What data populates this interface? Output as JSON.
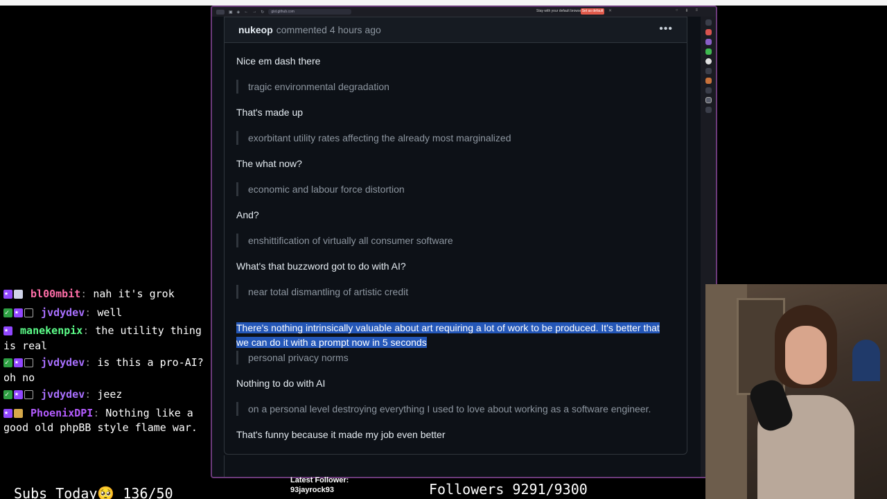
{
  "browser": {
    "url": "gist.github.com",
    "default_note": "Stay with your default browser",
    "default_button": "Set as default"
  },
  "comment": {
    "author": "nukeop",
    "meta": "commented 4 hours ago",
    "menu_icon": "kebab-horizontal-icon"
  },
  "lines": [
    {
      "kind": "text",
      "value": "Nice em dash there"
    },
    {
      "kind": "quote",
      "value": "tragic environmental degradation"
    },
    {
      "kind": "text",
      "value": "That's made up"
    },
    {
      "kind": "quote",
      "value": "exorbitant utility rates affecting the already most marginalized"
    },
    {
      "kind": "text",
      "value": "The what now?"
    },
    {
      "kind": "quote",
      "value": "economic and labour force distortion"
    },
    {
      "kind": "text",
      "value": "And?"
    },
    {
      "kind": "quote",
      "value": "enshittification of virtually all consumer software"
    },
    {
      "kind": "text",
      "value": "What's that buzzword got to do with AI?"
    },
    {
      "kind": "quote",
      "value": "near total dismantling of artistic credit"
    },
    {
      "kind": "selected",
      "value": "There's nothing intrinsically valuable about art requiring a lot of work to be produced. It's better that we can do it with a prompt now in 5 seconds"
    },
    {
      "kind": "quote",
      "value": "personal privacy norms"
    },
    {
      "kind": "text",
      "value": "Nothing to do with AI"
    },
    {
      "kind": "quote",
      "value": "on a personal level destroying everything I used to love about working as a software engineer."
    },
    {
      "kind": "text",
      "value": "That's funny because it made my job even better"
    }
  ],
  "chat": [
    {
      "user": "bl00mbit",
      "text": "nah it's grok"
    },
    {
      "user": "jvdydev",
      "text": "well"
    },
    {
      "user": "manekenpix",
      "text": "the utility thing is real"
    },
    {
      "user": "jvdydev",
      "text": "is this a pro-AI? oh no"
    },
    {
      "user": "jvdydev",
      "text": "jeez"
    },
    {
      "user": "PhoenixDPI",
      "text": "Nothing like a good old phpBB style flame war."
    }
  ],
  "overlay": {
    "subs": "Subs Today",
    "subs_count": "136/50",
    "latest_label": "Latest Follower:",
    "latest_name": "93jayrock93",
    "followers": "Followers 9291/9300"
  }
}
